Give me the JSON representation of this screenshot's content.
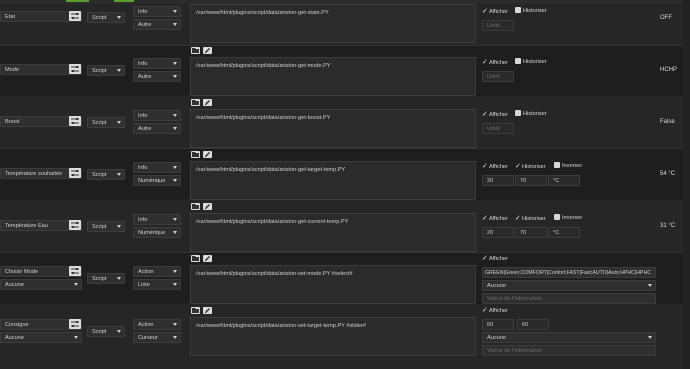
{
  "options": {
    "afficher": "Afficher",
    "historiser": "Historiser",
    "inverser": "Inverser"
  },
  "placeholders": {
    "unite": "Unité",
    "valeur": "Valeur de l'information"
  },
  "rows": [
    {
      "name": "Etat",
      "type": "Script",
      "subtype1": "Info",
      "subtype2": "Autre",
      "path": "/var/www/html/plugins/script/data/ariston-get-state.PY",
      "value": "OFF"
    },
    {
      "name": "Mode",
      "type": "Script",
      "subtype1": "Info",
      "subtype2": "Autre",
      "path": "/var/www/html/plugins/script/data/ariston-get-mode.PY",
      "value": "HCHP"
    },
    {
      "name": "Boost",
      "type": "Script",
      "subtype1": "Info",
      "subtype2": "Autre",
      "path": "/var/www/html/plugins/script/data/ariston-get-boost.PY",
      "value": "False"
    },
    {
      "name": "Température souhaitée",
      "type": "Script",
      "subtype1": "Info",
      "subtype2": "Numérique",
      "path": "/var/www/html/plugins/script/data/ariston-get-target-temp.PY",
      "min": "20",
      "max": "70",
      "unit": "°C",
      "value": "54 °C"
    },
    {
      "name": "Température Eau",
      "type": "Script",
      "subtype1": "Info",
      "subtype2": "Numérique",
      "path": "/var/www/html/plugins/script/data/ariston-get-current-temp.PY",
      "min": "20",
      "max": "70",
      "unit": "°C",
      "value": "31 °C"
    },
    {
      "name": "Choisir Mode",
      "linked": "Aucune",
      "type": "Script",
      "subtype1": "Action",
      "subtype2": "Liste",
      "path": "/var/www/html/plugins/script/data/ariston-set-mode.PY  #select#",
      "list": "GREEN|Green;COMFORT|Confort;FAST|Fast;AUTO|Auto;HPHC|HPHC",
      "select": "Aucune"
    },
    {
      "name": "Consigne",
      "linked": "Aucune",
      "type": "Script",
      "subtype1": "Action",
      "subtype2": "Curseur",
      "path": "/var/www/html/plugins/script/data/ariston-set-target-temp.PY #slider#",
      "min": "50",
      "max": "60",
      "select": "Aucune"
    }
  ]
}
